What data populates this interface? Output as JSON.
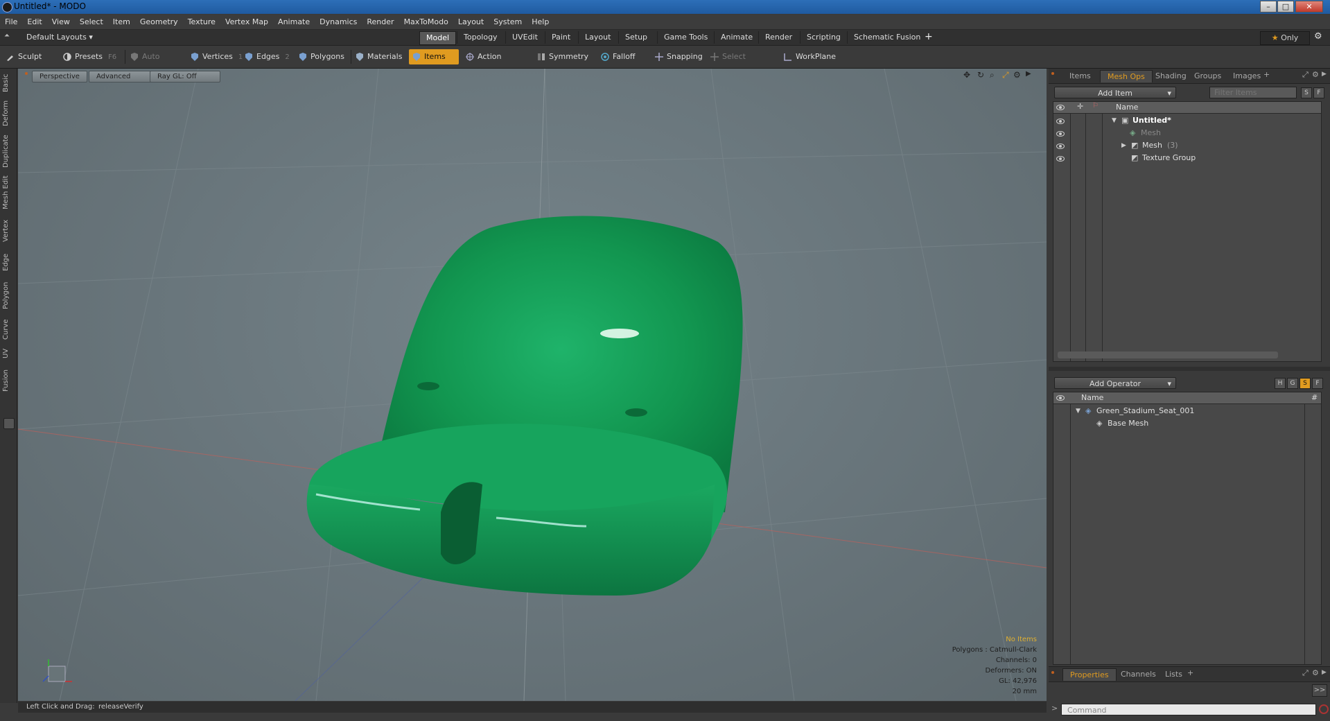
{
  "window": {
    "title": "Untitled* - MODO"
  },
  "menu": [
    "File",
    "Edit",
    "View",
    "Select",
    "Item",
    "Geometry",
    "Texture",
    "Vertex Map",
    "Animate",
    "Dynamics",
    "Render",
    "MaxToModo",
    "Layout",
    "System",
    "Help"
  ],
  "layout_selector": "Default Layouts",
  "layout_tabs": [
    "Model",
    "Topology",
    "UVEdit",
    "Paint",
    "Layout",
    "Setup",
    "Game Tools",
    "Animate",
    "Render",
    "Scripting",
    "Schematic Fusion"
  ],
  "active_layout_tab": "Model",
  "only_label": "Only",
  "toolbar": {
    "sculpt": "Sculpt",
    "presets": "Presets",
    "presets_key": "F6",
    "auto_select": "Auto Select",
    "vertices": "Vertices",
    "vertices_key": "1",
    "edges": "Edges",
    "edges_key": "2",
    "polygons": "Polygons",
    "materials": "Materials",
    "items": "Items",
    "action_center": "Action Center",
    "symmetry": "Symmetry",
    "falloff": "Falloff",
    "snapping": "Snapping",
    "select_through": "Select Through",
    "workplane": "WorkPlane"
  },
  "left_tabs": [
    "Basic",
    "Deform",
    "Duplicate",
    "Mesh Edit",
    "Vertex",
    "Edge",
    "Polygon",
    "Curve",
    "UV",
    "Fusion"
  ],
  "viewport": {
    "view_mode": "Perspective",
    "shading": "Advanced",
    "raygl": "Ray GL: Off",
    "info": {
      "selection": "No Items",
      "polygons": "Polygons : Catmull-Clark",
      "channels": "Channels: 0",
      "deformers": "Deformers: ON",
      "gl": "GL: 42,976",
      "scale": "20 mm"
    }
  },
  "status": {
    "label": "Left Click and Drag:",
    "value": "releaseVerify"
  },
  "items_panel": {
    "tabs": [
      "Items",
      "Mesh Ops",
      "Shading",
      "Groups",
      "Images"
    ],
    "active_tab": "Mesh Ops",
    "add_item": "Add Item",
    "filter_placeholder": "Filter Items",
    "s_btn": "S",
    "f_btn": "F",
    "name_header": "Name",
    "rows": [
      {
        "label": "Untitled*"
      },
      {
        "label": "Mesh"
      },
      {
        "label": "Mesh",
        "count": "(3)"
      },
      {
        "label": "Texture Group"
      }
    ]
  },
  "operators_panel": {
    "add_operator": "Add Operator",
    "btns": [
      "H",
      "G",
      "S",
      "F"
    ],
    "name_header": "Name",
    "hash_header": "#",
    "rows": [
      {
        "label": "Green_Stadium_Seat_001"
      },
      {
        "label": "Base Mesh"
      }
    ]
  },
  "properties_panel": {
    "tabs": [
      "Properties",
      "Channels",
      "Lists"
    ],
    "active_tab": "Properties",
    "expand_btn": ">>",
    "command_placeholder": "Command"
  },
  "colors": {
    "accent": "#e09b20",
    "seat": "#1a9a5c",
    "viewport_bg": "#6a777d"
  }
}
